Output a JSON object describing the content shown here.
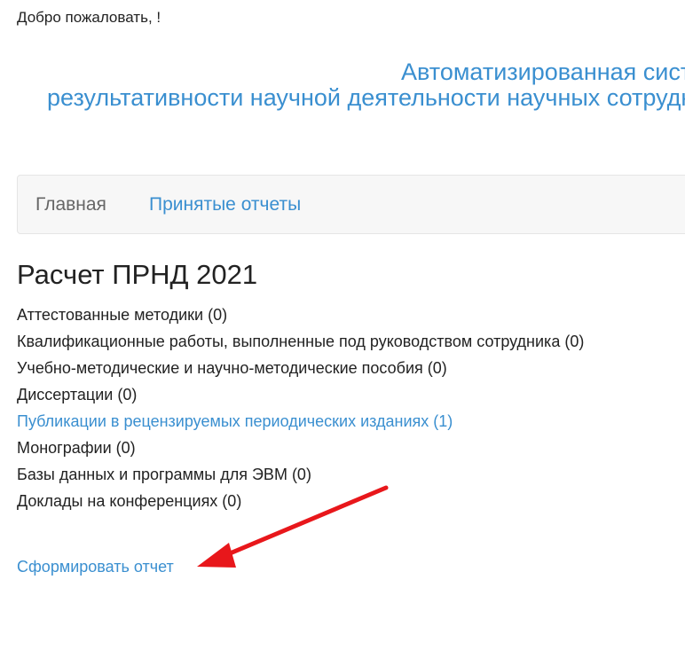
{
  "header": {
    "welcome": "Добро пожаловать, !",
    "title_line1": "Автоматизированная система",
    "title_line2": "результативности научной деятельности научных сотрудников"
  },
  "navbar": {
    "home_label": "Главная",
    "accepted_reports_label": "Принятые отчеты"
  },
  "main": {
    "heading": "Расчет ПРНД 2021",
    "items": [
      {
        "label": "Аттестованные методики (0)",
        "link": false
      },
      {
        "label": "Квалификационные работы, выполненные под руководством сотрудника (0)",
        "link": false
      },
      {
        "label": "Учебно-методические и научно-методические пособия (0)",
        "link": false
      },
      {
        "label": "Диссертации (0)",
        "link": false
      },
      {
        "label": "Публикации в рецензируемых периодических изданиях (1)",
        "link": true
      },
      {
        "label": "Монографии (0)",
        "link": false
      },
      {
        "label": "Базы данных и программы для ЭВМ (0)",
        "link": false
      },
      {
        "label": "Доклады на конференциях (0)",
        "link": false
      }
    ],
    "generate_report_label": "Сформировать отчет"
  },
  "annotation": {
    "arrow_color": "#e8171b",
    "arrow_icon": "red-arrow-pointing-left"
  },
  "colors": {
    "link": "#3a8fd0",
    "text": "#222222",
    "navbar_bg": "#f7f7f7",
    "navbar_border": "#e5e5e5"
  }
}
